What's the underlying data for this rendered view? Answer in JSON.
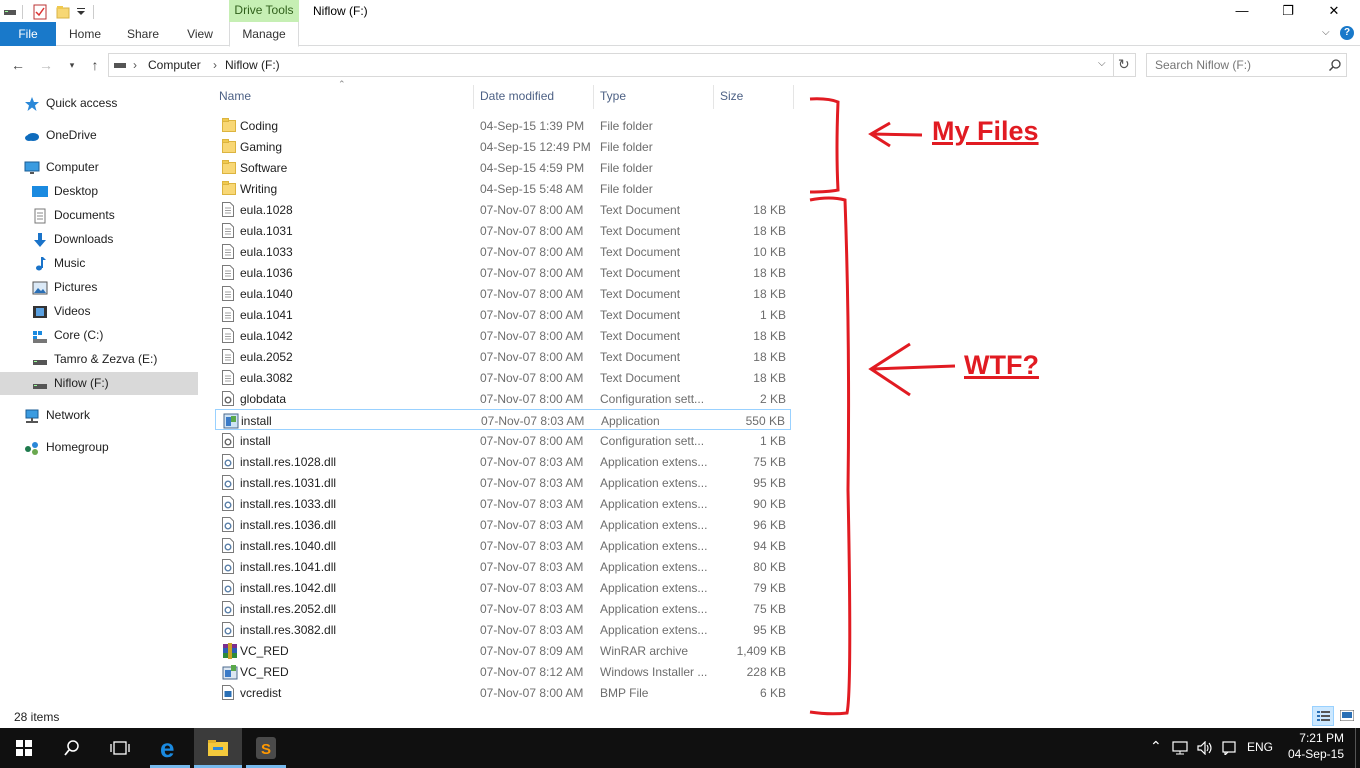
{
  "window": {
    "title": "Niflow (F:)",
    "context_tab_group": "Drive Tools",
    "minimize": "—",
    "maximize": "❐",
    "close": "✕"
  },
  "ribbon": {
    "tabs": [
      "File",
      "Home",
      "Share",
      "View",
      "Manage"
    ]
  },
  "address": {
    "crumbs": [
      "Computer",
      "Niflow (F:)"
    ],
    "search_placeholder": "Search Niflow (F:)"
  },
  "nav": {
    "items": [
      {
        "label": "Quick access",
        "icon": "star-icon"
      },
      {
        "label": "OneDrive",
        "icon": "cloud-icon"
      },
      {
        "label": "Computer",
        "icon": "monitor-icon"
      },
      {
        "label": "Desktop",
        "icon": "desktop-icon"
      },
      {
        "label": "Documents",
        "icon": "documents-icon"
      },
      {
        "label": "Downloads",
        "icon": "downloads-icon"
      },
      {
        "label": "Music",
        "icon": "music-icon"
      },
      {
        "label": "Pictures",
        "icon": "pictures-icon"
      },
      {
        "label": "Videos",
        "icon": "videos-icon"
      },
      {
        "label": "Core (C:)",
        "icon": "windows-drive-icon"
      },
      {
        "label": "Tamro & Zezva (E:)",
        "icon": "drive-icon"
      },
      {
        "label": "Niflow (F:)",
        "icon": "drive-icon"
      },
      {
        "label": "Network",
        "icon": "network-icon"
      },
      {
        "label": "Homegroup",
        "icon": "homegroup-icon"
      }
    ]
  },
  "columns": [
    "Name",
    "Date modified",
    "Type",
    "Size"
  ],
  "files": [
    {
      "name": "Coding",
      "date": "04-Sep-15 1:39 PM",
      "type": "File folder",
      "size": "",
      "icon": "folder"
    },
    {
      "name": "Gaming",
      "date": "04-Sep-15 12:49 PM",
      "type": "File folder",
      "size": "",
      "icon": "folder"
    },
    {
      "name": "Software",
      "date": "04-Sep-15 4:59 PM",
      "type": "File folder",
      "size": "",
      "icon": "folder"
    },
    {
      "name": "Writing",
      "date": "04-Sep-15 5:48 AM",
      "type": "File folder",
      "size": "",
      "icon": "folder"
    },
    {
      "name": "eula.1028",
      "date": "07-Nov-07 8:00 AM",
      "type": "Text Document",
      "size": "18 KB",
      "icon": "text"
    },
    {
      "name": "eula.1031",
      "date": "07-Nov-07 8:00 AM",
      "type": "Text Document",
      "size": "18 KB",
      "icon": "text"
    },
    {
      "name": "eula.1033",
      "date": "07-Nov-07 8:00 AM",
      "type": "Text Document",
      "size": "10 KB",
      "icon": "text"
    },
    {
      "name": "eula.1036",
      "date": "07-Nov-07 8:00 AM",
      "type": "Text Document",
      "size": "18 KB",
      "icon": "text"
    },
    {
      "name": "eula.1040",
      "date": "07-Nov-07 8:00 AM",
      "type": "Text Document",
      "size": "18 KB",
      "icon": "text"
    },
    {
      "name": "eula.1041",
      "date": "07-Nov-07 8:00 AM",
      "type": "Text Document",
      "size": "1 KB",
      "icon": "text"
    },
    {
      "name": "eula.1042",
      "date": "07-Nov-07 8:00 AM",
      "type": "Text Document",
      "size": "18 KB",
      "icon": "text"
    },
    {
      "name": "eula.2052",
      "date": "07-Nov-07 8:00 AM",
      "type": "Text Document",
      "size": "18 KB",
      "icon": "text"
    },
    {
      "name": "eula.3082",
      "date": "07-Nov-07 8:00 AM",
      "type": "Text Document",
      "size": "18 KB",
      "icon": "text"
    },
    {
      "name": "globdata",
      "date": "07-Nov-07 8:00 AM",
      "type": "Configuration sett...",
      "size": "2 KB",
      "icon": "config"
    },
    {
      "name": "install",
      "date": "07-Nov-07 8:03 AM",
      "type": "Application",
      "size": "550 KB",
      "icon": "app"
    },
    {
      "name": "install",
      "date": "07-Nov-07 8:00 AM",
      "type": "Configuration sett...",
      "size": "1 KB",
      "icon": "config"
    },
    {
      "name": "install.res.1028.dll",
      "date": "07-Nov-07 8:03 AM",
      "type": "Application extens...",
      "size": "75 KB",
      "icon": "dll"
    },
    {
      "name": "install.res.1031.dll",
      "date": "07-Nov-07 8:03 AM",
      "type": "Application extens...",
      "size": "95 KB",
      "icon": "dll"
    },
    {
      "name": "install.res.1033.dll",
      "date": "07-Nov-07 8:03 AM",
      "type": "Application extens...",
      "size": "90 KB",
      "icon": "dll"
    },
    {
      "name": "install.res.1036.dll",
      "date": "07-Nov-07 8:03 AM",
      "type": "Application extens...",
      "size": "96 KB",
      "icon": "dll"
    },
    {
      "name": "install.res.1040.dll",
      "date": "07-Nov-07 8:03 AM",
      "type": "Application extens...",
      "size": "94 KB",
      "icon": "dll"
    },
    {
      "name": "install.res.1041.dll",
      "date": "07-Nov-07 8:03 AM",
      "type": "Application extens...",
      "size": "80 KB",
      "icon": "dll"
    },
    {
      "name": "install.res.1042.dll",
      "date": "07-Nov-07 8:03 AM",
      "type": "Application extens...",
      "size": "79 KB",
      "icon": "dll"
    },
    {
      "name": "install.res.2052.dll",
      "date": "07-Nov-07 8:03 AM",
      "type": "Application extens...",
      "size": "75 KB",
      "icon": "dll"
    },
    {
      "name": "install.res.3082.dll",
      "date": "07-Nov-07 8:03 AM",
      "type": "Application extens...",
      "size": "95 KB",
      "icon": "dll"
    },
    {
      "name": "VC_RED",
      "date": "07-Nov-07 8:09 AM",
      "type": "WinRAR archive",
      "size": "1,409 KB",
      "icon": "rar"
    },
    {
      "name": "VC_RED",
      "date": "07-Nov-07 8:12 AM",
      "type": "Windows Installer ...",
      "size": "228 KB",
      "icon": "msi"
    },
    {
      "name": "vcredist",
      "date": "07-Nov-07 8:00 AM",
      "type": "BMP File",
      "size": "6 KB",
      "icon": "bmp"
    }
  ],
  "selected_index": 14,
  "status": {
    "item_count": "28 items"
  },
  "annotations": {
    "my_files": "My Files",
    "wtf": "WTF?",
    "color": "#e11b22"
  },
  "taskbar": {
    "time": "7:21 PM",
    "date": "04-Sep-15",
    "language": "ENG"
  },
  "colors": {
    "accent": "#1979ca",
    "context_tab": "#c6efb4",
    "selection_border": "#99d1ff"
  }
}
